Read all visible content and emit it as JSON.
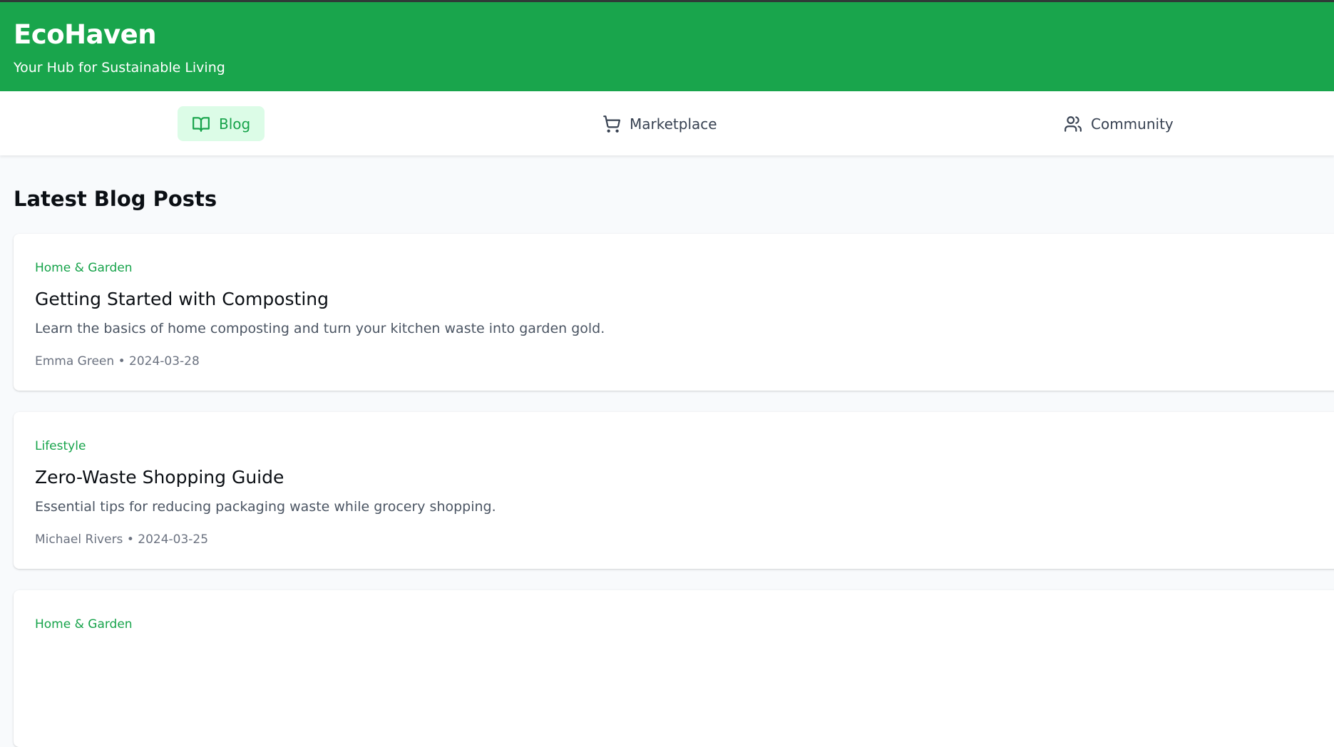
{
  "header": {
    "brand": "EcoHaven",
    "tagline": "Your Hub for Sustainable Living"
  },
  "nav": {
    "items": [
      {
        "label": "Blog",
        "icon": "book-open-icon",
        "active": true
      },
      {
        "label": "Marketplace",
        "icon": "shopping-cart-icon",
        "active": false
      },
      {
        "label": "Community",
        "icon": "users-icon",
        "active": false
      }
    ]
  },
  "main": {
    "section_title": "Latest Blog Posts",
    "posts": [
      {
        "category": "Home & Garden",
        "title": "Getting Started with Composting",
        "excerpt": "Learn the basics of home composting and turn your kitchen waste into garden gold.",
        "author": "Emma Green",
        "date": "2024-03-28",
        "meta": "Emma Green • 2024-03-28"
      },
      {
        "category": "Lifestyle",
        "title": "Zero-Waste Shopping Guide",
        "excerpt": "Essential tips for reducing packaging waste while grocery shopping.",
        "author": "Michael Rivers",
        "date": "2024-03-25",
        "meta": "Michael Rivers • 2024-03-25"
      },
      {
        "category": "Home & Garden"
      }
    ]
  },
  "colors": {
    "brand_green": "#19a54c",
    "accent_green": "#16a34a",
    "active_bg": "#dcfce7",
    "page_bg": "#f8fafc"
  }
}
